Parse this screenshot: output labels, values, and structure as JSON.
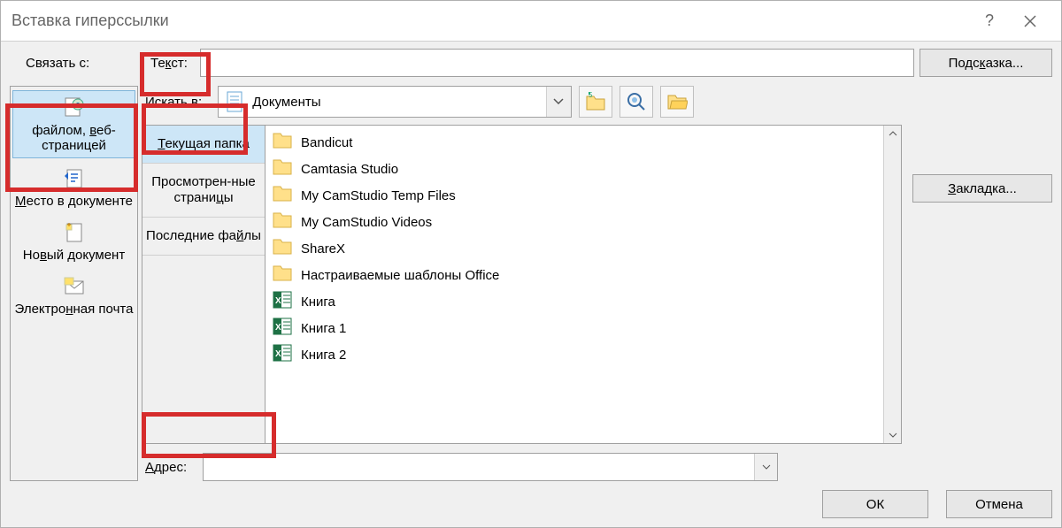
{
  "title": "Вставка гиперссылки",
  "labels": {
    "link_to": "Связать с:",
    "text": "Текст:",
    "search_in": "Искать в:",
    "address": "Адрес:"
  },
  "buttons": {
    "hint": "Подсказка...",
    "bookmark": "Закладка...",
    "ok": "ОК",
    "cancel": "Отмена"
  },
  "link_to_items": [
    {
      "id": "file-web",
      "label": "файлом, веб-страницей",
      "selected": true
    },
    {
      "id": "place-in-doc",
      "label": "Место в документе",
      "selected": false
    },
    {
      "id": "new-doc",
      "label": "Новый документ",
      "selected": false
    },
    {
      "id": "email",
      "label": "Электронная почта",
      "selected": false
    }
  ],
  "tabs": [
    {
      "id": "current-folder",
      "label": "Текущая папка",
      "selected": true
    },
    {
      "id": "browsed-pages",
      "label": "Просмотренные страницы",
      "selected": false
    },
    {
      "id": "recent-files",
      "label": "Последние файлы",
      "selected": false
    }
  ],
  "lookin": {
    "value": "Документы"
  },
  "files": [
    {
      "type": "folder",
      "name": "Bandicut"
    },
    {
      "type": "folder",
      "name": "Camtasia Studio"
    },
    {
      "type": "folder",
      "name": "My CamStudio Temp Files"
    },
    {
      "type": "folder",
      "name": "My CamStudio Videos"
    },
    {
      "type": "folder",
      "name": "ShareX"
    },
    {
      "type": "folder",
      "name": "Настраиваемые шаблоны Office"
    },
    {
      "type": "excel",
      "name": "Книга"
    },
    {
      "type": "excel",
      "name": "Книга 1"
    },
    {
      "type": "excel",
      "name": "Книга 2"
    }
  ],
  "text_value": "",
  "address_value": ""
}
